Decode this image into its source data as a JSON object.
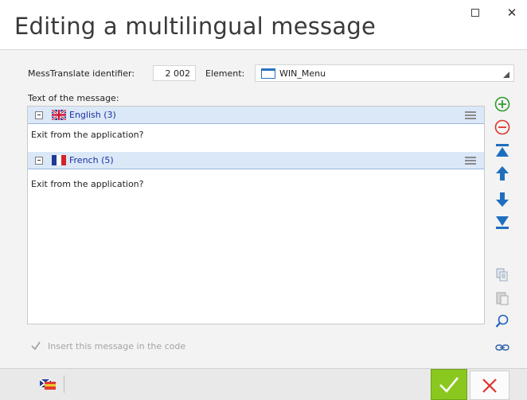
{
  "window": {
    "title": "Editing a multilingual message",
    "maximize_glyph": "☐",
    "close_glyph": "✕"
  },
  "form": {
    "identifier_label": "MessTranslate identifier:",
    "identifier_value": "2 002",
    "element_label": "Element:",
    "element_value": "WIN_Menu",
    "text_label": "Text of the message:"
  },
  "messages": [
    {
      "language": "English (3)",
      "text": "Exit from the application?",
      "flag": "uk-flag-icon"
    },
    {
      "language": "French (5)",
      "text": "Exit from the application?",
      "flag": "france-flag-icon"
    }
  ],
  "toolbar": [
    {
      "name": "add-language-icon",
      "color": "#2e9b2e"
    },
    {
      "name": "remove-language-icon",
      "color": "#d9342b"
    },
    {
      "name": "move-top-icon",
      "color": "#1f6fbf"
    },
    {
      "name": "move-up-icon",
      "color": "#1f6fbf"
    },
    {
      "name": "move-down-icon",
      "color": "#1f6fbf"
    },
    {
      "name": "move-bottom-icon",
      "color": "#1f6fbf"
    },
    {
      "name": "copy-icon",
      "color": "#9aa9bb"
    },
    {
      "name": "paste-icon",
      "color": "#a8a8a8"
    },
    {
      "name": "search-icon",
      "color": "#1f5fbf"
    },
    {
      "name": "link-icon",
      "color": "#2a5ea8"
    }
  ],
  "options": {
    "insert_label": "Insert this message in the code",
    "insert_checked": true
  },
  "buttons": {
    "ok_color": "#8ac81f",
    "cancel_color": "#e0322f"
  }
}
